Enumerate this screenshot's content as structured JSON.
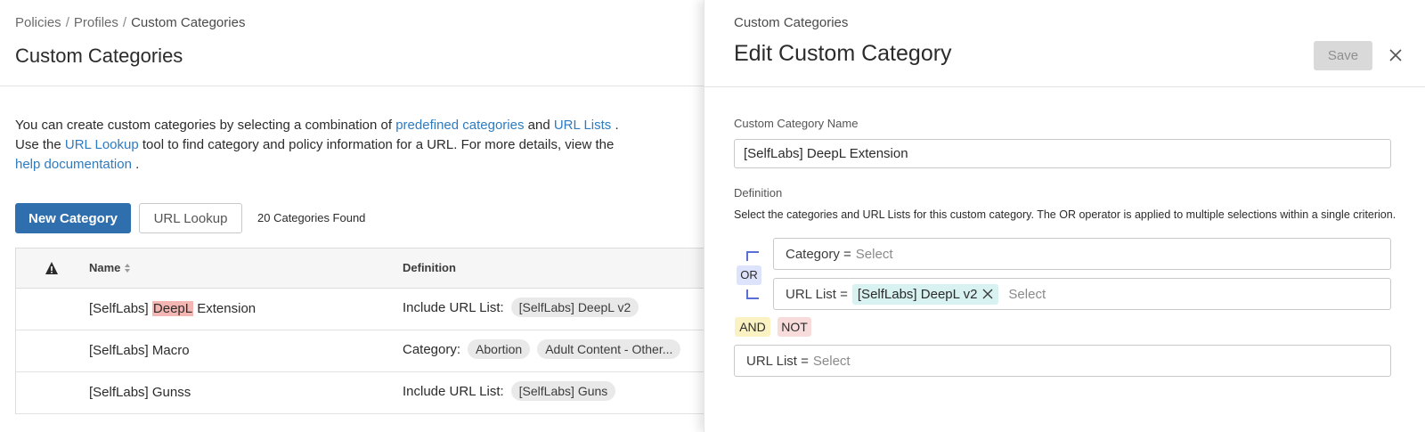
{
  "breadcrumb": {
    "items": [
      "Policies",
      "Profiles",
      "Custom Categories"
    ],
    "separator": "/"
  },
  "page": {
    "title": "Custom Categories",
    "intro": {
      "t1": "You can create custom categories by selecting a combination of ",
      "link1": "predefined categories",
      "t2": " and ",
      "link2": "URL Lists",
      "t3": " . Use the ",
      "link3": "URL Lookup",
      "t4": " tool to find category and policy information for a URL. For more details, view the ",
      "link4": "help documentation",
      "t5": " ."
    },
    "new_button": "New Category",
    "lookup_button": "URL Lookup",
    "count": "20 Categories Found"
  },
  "table": {
    "columns": {
      "name": "Name",
      "definition": "Definition"
    },
    "rows": [
      {
        "name_pre": "[SelfLabs] ",
        "name_hl": "DeepL",
        "name_post": " Extension",
        "def_label": "Include URL List:",
        "chips": [
          "[SelfLabs] DeepL v2"
        ]
      },
      {
        "name_pre": "[SelfLabs] Macro",
        "name_hl": "",
        "name_post": "",
        "def_label": "Category:",
        "chips": [
          "Abortion",
          "Adult Content - Other..."
        ]
      },
      {
        "name_pre": "[SelfLabs] Gunss",
        "name_hl": "",
        "name_post": "",
        "def_label": "Include URL List:",
        "chips": [
          "[SelfLabs] Guns"
        ]
      }
    ]
  },
  "panel": {
    "crumb": "Custom Categories",
    "title": "Edit Custom Category",
    "save": "Save",
    "name_label": "Custom Category Name",
    "name_value": "[SelfLabs] DeepL Extension",
    "def_label": "Definition",
    "def_desc": "Select the categories and URL Lists for this custom category. The OR operator is applied to multiple selections within a single criterion.",
    "or": "OR",
    "criterion1": {
      "label": "Category =",
      "placeholder": "Select"
    },
    "criterion2": {
      "label": "URL List =",
      "tag": "[SelfLabs] DeepL v2",
      "placeholder": "Select"
    },
    "and": "AND",
    "not": "NOT",
    "criterion3": {
      "label": "URL List =",
      "placeholder": "Select"
    }
  },
  "icons": {
    "warning": "warning-triangle-icon",
    "sort": "sort-icon",
    "close": "close-icon",
    "remove_tag": "remove-tag-icon"
  },
  "colors": {
    "primary": "#2f6fae",
    "link": "#2f7bbf",
    "highlight": "#f4b6b3",
    "or_badge": "#dde3fb",
    "and_badge": "#fbf2c4",
    "not_badge": "#f8dcdc",
    "tag": "#d8f1f1"
  }
}
